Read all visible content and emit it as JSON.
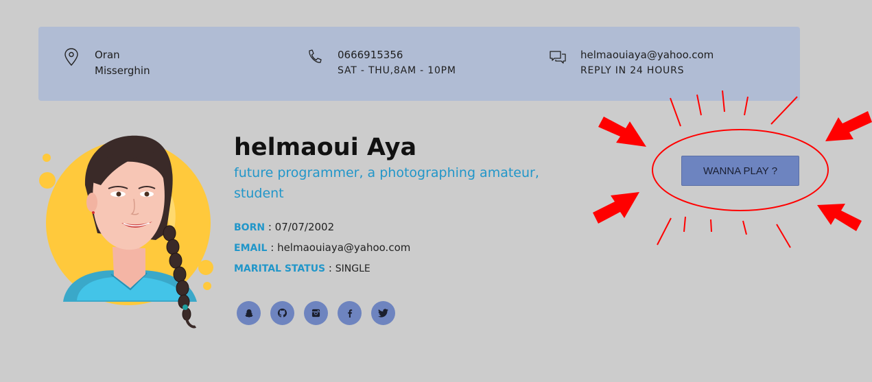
{
  "contact": {
    "location": {
      "line1": "Oran",
      "line2": "Misserghin",
      "icon": "map-pin-icon"
    },
    "phone": {
      "line1": "0666915356",
      "line2": "SAT - THU,8AM - 10PM",
      "icon": "phone-icon"
    },
    "email": {
      "line1": "helmaouiaya@yahoo.com",
      "line2": "REPLY IN 24 HOURS",
      "icon": "chat-bubbles-icon"
    }
  },
  "profile": {
    "name": "helmaoui Aya",
    "tagline": "future programmer, a photographing amateur, student",
    "born_label": "BORN",
    "born_value": "07/07/2002",
    "email_label": "EMAIL",
    "email_value": "helmaouiaya@yahoo.com",
    "marital_label": "MARITAL STATUS",
    "marital_value": "SINGLE"
  },
  "socials": [
    "snapchat-icon",
    "github-icon",
    "instagram-icon",
    "facebook-icon",
    "twitter-icon"
  ],
  "play_button": {
    "label": "WANNA PLAY ?"
  },
  "colors": {
    "background": "#cccccc",
    "contact_bar": "#b0bcd4",
    "accent": "#2196c9",
    "social_bg": "#6e84bf",
    "button_bg": "#6d84c0",
    "annotation_red": "#ff0000"
  }
}
